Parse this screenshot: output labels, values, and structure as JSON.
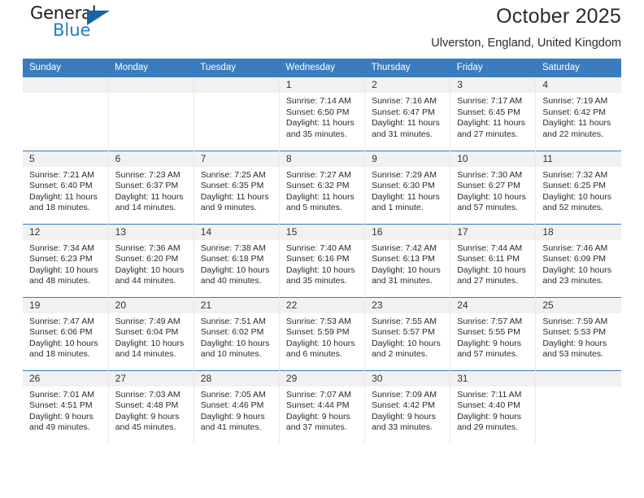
{
  "brand": {
    "name_part1": "General",
    "name_part2": "Blue",
    "accent_color": "#1d7fc4",
    "triangle_color": "#1565a8"
  },
  "header": {
    "title": "October 2025",
    "subtitle": "Ulverston, England, United Kingdom"
  },
  "theme": {
    "header_row_bg": "#3a7cbe",
    "daynum_bg": "#f1f1f1",
    "grid_line": "#e9e9e9",
    "week_separator": "#3a7cbe"
  },
  "weekday_headers": [
    "Sunday",
    "Monday",
    "Tuesday",
    "Wednesday",
    "Thursday",
    "Friday",
    "Saturday"
  ],
  "weeks": [
    [
      {
        "empty": true
      },
      {
        "empty": true
      },
      {
        "empty": true
      },
      {
        "day": "1",
        "sunrise": "Sunrise: 7:14 AM",
        "sunset": "Sunset: 6:50 PM",
        "daylight1": "Daylight: 11 hours",
        "daylight2": "and 35 minutes."
      },
      {
        "day": "2",
        "sunrise": "Sunrise: 7:16 AM",
        "sunset": "Sunset: 6:47 PM",
        "daylight1": "Daylight: 11 hours",
        "daylight2": "and 31 minutes."
      },
      {
        "day": "3",
        "sunrise": "Sunrise: 7:17 AM",
        "sunset": "Sunset: 6:45 PM",
        "daylight1": "Daylight: 11 hours",
        "daylight2": "and 27 minutes."
      },
      {
        "day": "4",
        "sunrise": "Sunrise: 7:19 AM",
        "sunset": "Sunset: 6:42 PM",
        "daylight1": "Daylight: 11 hours",
        "daylight2": "and 22 minutes."
      }
    ],
    [
      {
        "day": "5",
        "sunrise": "Sunrise: 7:21 AM",
        "sunset": "Sunset: 6:40 PM",
        "daylight1": "Daylight: 11 hours",
        "daylight2": "and 18 minutes."
      },
      {
        "day": "6",
        "sunrise": "Sunrise: 7:23 AM",
        "sunset": "Sunset: 6:37 PM",
        "daylight1": "Daylight: 11 hours",
        "daylight2": "and 14 minutes."
      },
      {
        "day": "7",
        "sunrise": "Sunrise: 7:25 AM",
        "sunset": "Sunset: 6:35 PM",
        "daylight1": "Daylight: 11 hours",
        "daylight2": "and 9 minutes."
      },
      {
        "day": "8",
        "sunrise": "Sunrise: 7:27 AM",
        "sunset": "Sunset: 6:32 PM",
        "daylight1": "Daylight: 11 hours",
        "daylight2": "and 5 minutes."
      },
      {
        "day": "9",
        "sunrise": "Sunrise: 7:29 AM",
        "sunset": "Sunset: 6:30 PM",
        "daylight1": "Daylight: 11 hours",
        "daylight2": "and 1 minute."
      },
      {
        "day": "10",
        "sunrise": "Sunrise: 7:30 AM",
        "sunset": "Sunset: 6:27 PM",
        "daylight1": "Daylight: 10 hours",
        "daylight2": "and 57 minutes."
      },
      {
        "day": "11",
        "sunrise": "Sunrise: 7:32 AM",
        "sunset": "Sunset: 6:25 PM",
        "daylight1": "Daylight: 10 hours",
        "daylight2": "and 52 minutes."
      }
    ],
    [
      {
        "day": "12",
        "sunrise": "Sunrise: 7:34 AM",
        "sunset": "Sunset: 6:23 PM",
        "daylight1": "Daylight: 10 hours",
        "daylight2": "and 48 minutes."
      },
      {
        "day": "13",
        "sunrise": "Sunrise: 7:36 AM",
        "sunset": "Sunset: 6:20 PM",
        "daylight1": "Daylight: 10 hours",
        "daylight2": "and 44 minutes."
      },
      {
        "day": "14",
        "sunrise": "Sunrise: 7:38 AM",
        "sunset": "Sunset: 6:18 PM",
        "daylight1": "Daylight: 10 hours",
        "daylight2": "and 40 minutes."
      },
      {
        "day": "15",
        "sunrise": "Sunrise: 7:40 AM",
        "sunset": "Sunset: 6:16 PM",
        "daylight1": "Daylight: 10 hours",
        "daylight2": "and 35 minutes."
      },
      {
        "day": "16",
        "sunrise": "Sunrise: 7:42 AM",
        "sunset": "Sunset: 6:13 PM",
        "daylight1": "Daylight: 10 hours",
        "daylight2": "and 31 minutes."
      },
      {
        "day": "17",
        "sunrise": "Sunrise: 7:44 AM",
        "sunset": "Sunset: 6:11 PM",
        "daylight1": "Daylight: 10 hours",
        "daylight2": "and 27 minutes."
      },
      {
        "day": "18",
        "sunrise": "Sunrise: 7:46 AM",
        "sunset": "Sunset: 6:09 PM",
        "daylight1": "Daylight: 10 hours",
        "daylight2": "and 23 minutes."
      }
    ],
    [
      {
        "day": "19",
        "sunrise": "Sunrise: 7:47 AM",
        "sunset": "Sunset: 6:06 PM",
        "daylight1": "Daylight: 10 hours",
        "daylight2": "and 18 minutes."
      },
      {
        "day": "20",
        "sunrise": "Sunrise: 7:49 AM",
        "sunset": "Sunset: 6:04 PM",
        "daylight1": "Daylight: 10 hours",
        "daylight2": "and 14 minutes."
      },
      {
        "day": "21",
        "sunrise": "Sunrise: 7:51 AM",
        "sunset": "Sunset: 6:02 PM",
        "daylight1": "Daylight: 10 hours",
        "daylight2": "and 10 minutes."
      },
      {
        "day": "22",
        "sunrise": "Sunrise: 7:53 AM",
        "sunset": "Sunset: 5:59 PM",
        "daylight1": "Daylight: 10 hours",
        "daylight2": "and 6 minutes."
      },
      {
        "day": "23",
        "sunrise": "Sunrise: 7:55 AM",
        "sunset": "Sunset: 5:57 PM",
        "daylight1": "Daylight: 10 hours",
        "daylight2": "and 2 minutes."
      },
      {
        "day": "24",
        "sunrise": "Sunrise: 7:57 AM",
        "sunset": "Sunset: 5:55 PM",
        "daylight1": "Daylight: 9 hours",
        "daylight2": "and 57 minutes."
      },
      {
        "day": "25",
        "sunrise": "Sunrise: 7:59 AM",
        "sunset": "Sunset: 5:53 PM",
        "daylight1": "Daylight: 9 hours",
        "daylight2": "and 53 minutes."
      }
    ],
    [
      {
        "day": "26",
        "sunrise": "Sunrise: 7:01 AM",
        "sunset": "Sunset: 4:51 PM",
        "daylight1": "Daylight: 9 hours",
        "daylight2": "and 49 minutes."
      },
      {
        "day": "27",
        "sunrise": "Sunrise: 7:03 AM",
        "sunset": "Sunset: 4:48 PM",
        "daylight1": "Daylight: 9 hours",
        "daylight2": "and 45 minutes."
      },
      {
        "day": "28",
        "sunrise": "Sunrise: 7:05 AM",
        "sunset": "Sunset: 4:46 PM",
        "daylight1": "Daylight: 9 hours",
        "daylight2": "and 41 minutes."
      },
      {
        "day": "29",
        "sunrise": "Sunrise: 7:07 AM",
        "sunset": "Sunset: 4:44 PM",
        "daylight1": "Daylight: 9 hours",
        "daylight2": "and 37 minutes."
      },
      {
        "day": "30",
        "sunrise": "Sunrise: 7:09 AM",
        "sunset": "Sunset: 4:42 PM",
        "daylight1": "Daylight: 9 hours",
        "daylight2": "and 33 minutes."
      },
      {
        "day": "31",
        "sunrise": "Sunrise: 7:11 AM",
        "sunset": "Sunset: 4:40 PM",
        "daylight1": "Daylight: 9 hours",
        "daylight2": "and 29 minutes."
      },
      {
        "empty": true
      }
    ]
  ]
}
